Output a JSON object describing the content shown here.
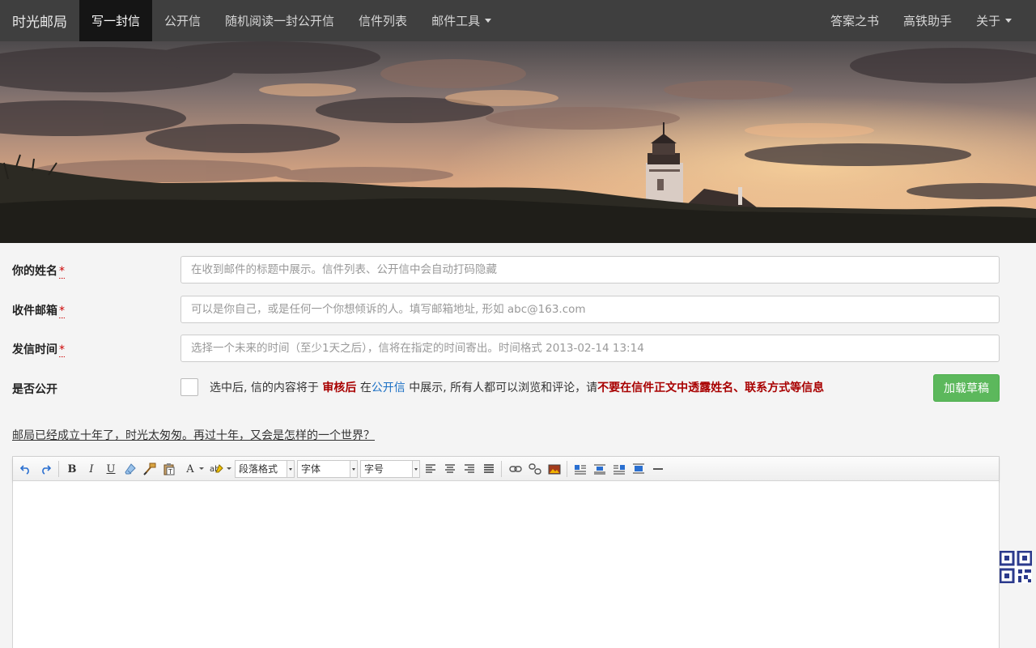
{
  "navbar": {
    "brand": "时光邮局",
    "items": [
      {
        "label": "写一封信",
        "active": true
      },
      {
        "label": "公开信"
      },
      {
        "label": "随机阅读一封公开信"
      },
      {
        "label": "信件列表"
      },
      {
        "label": "邮件工具",
        "dropdown": true
      }
    ],
    "right_items": [
      {
        "label": "答案之书"
      },
      {
        "label": "高铁助手"
      },
      {
        "label": "关于",
        "dropdown": true
      }
    ]
  },
  "form": {
    "name_label": "你的姓名",
    "name_placeholder": "在收到邮件的标题中展示。信件列表、公开信中会自动打码隐藏",
    "email_label": "收件邮箱",
    "email_placeholder": "可以是你自己，或是任何一个你想倾诉的人。填写邮箱地址, 形如 abc@163.com",
    "time_label": "发信时间",
    "time_placeholder": "选择一个未来的时间（至少1天之后），信将在指定的时间寄出。时间格式 2013-02-14 13:14",
    "required_mark": "*",
    "public_label": "是否公开",
    "public_text_1": "选中后, 信的内容将于",
    "public_text_review": "审核后",
    "public_text_2": "在",
    "public_text_link": "公开信",
    "public_text_3": "中展示, 所有人都可以浏览和评论，请",
    "public_text_warning": "不要在信件正文中透露姓名、联系方式等信息",
    "draft_button": "加载草稿",
    "intro_text": "邮局已经成立十年了，时光太匆匆。再过十年，又会是怎样的一个世界？"
  },
  "editor": {
    "paragraph_format": "段落格式",
    "font_family": "字体",
    "font_size": "字号"
  },
  "colors": {
    "navbar_bg": "#3f3f3f",
    "nav_active_bg": "#151515",
    "required_red": "#cc0000",
    "warning_red": "#a80000",
    "link_blue": "#1a6fc4",
    "success_green": "#5cb85c"
  }
}
